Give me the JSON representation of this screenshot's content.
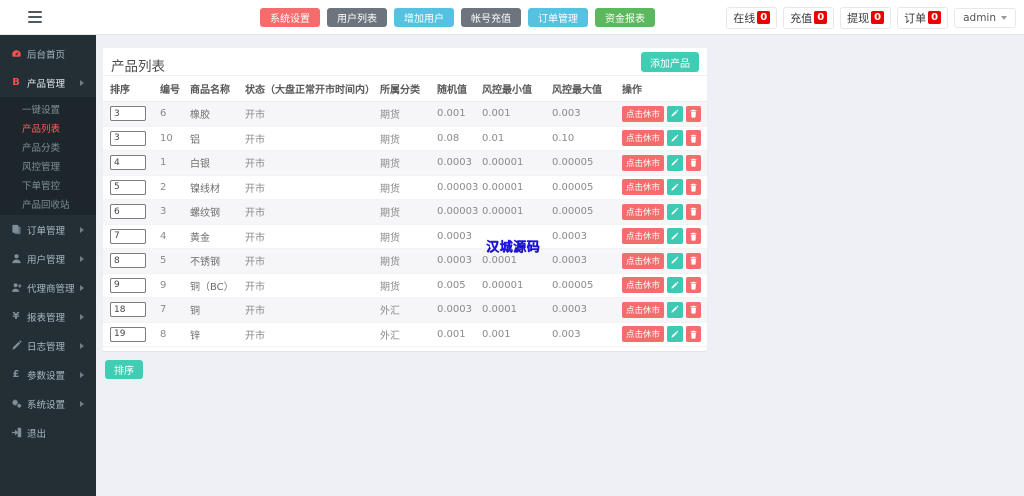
{
  "header": {
    "quick_buttons": [
      {
        "label": "系统设置",
        "style": "red"
      },
      {
        "label": "用户列表",
        "style": "gray"
      },
      {
        "label": "增加用户",
        "style": "blue"
      },
      {
        "label": "帐号充值",
        "style": "gray"
      },
      {
        "label": "订单管理",
        "style": "blue"
      },
      {
        "label": "资金报表",
        "style": "green"
      }
    ],
    "stats": [
      {
        "label": "在线",
        "value": "0"
      },
      {
        "label": "充值",
        "value": "0"
      },
      {
        "label": "提现",
        "value": "0"
      },
      {
        "label": "订单",
        "value": "0"
      }
    ],
    "user": {
      "name": "admin"
    }
  },
  "sidebar": {
    "items": [
      {
        "label": "后台首页",
        "icon": "dashboard-icon",
        "red": true,
        "arrow": false
      },
      {
        "label": "产品管理",
        "icon": "product-icon",
        "red": true,
        "arrow": true,
        "active": true,
        "children": [
          {
            "label": "一键设置",
            "active": false
          },
          {
            "label": "产品列表",
            "active": true
          },
          {
            "label": "产品分类",
            "active": false
          },
          {
            "label": "风控管理",
            "active": false
          },
          {
            "label": "下单管控",
            "active": false
          },
          {
            "label": "产品回收站",
            "active": false
          }
        ]
      },
      {
        "label": "订单管理",
        "icon": "orders-icon",
        "red": false,
        "arrow": true
      },
      {
        "label": "用户管理",
        "icon": "users-icon",
        "red": false,
        "arrow": true
      },
      {
        "label": "代理商管理",
        "icon": "agents-icon",
        "red": false,
        "arrow": true
      },
      {
        "label": "报表管理",
        "icon": "reports-icon",
        "red": false,
        "arrow": true
      },
      {
        "label": "日志管理",
        "icon": "logs-icon",
        "red": false,
        "arrow": true
      },
      {
        "label": "参数设置",
        "icon": "params-icon",
        "red": false,
        "arrow": true
      },
      {
        "label": "系统设置",
        "icon": "system-icon",
        "red": false,
        "arrow": true
      },
      {
        "label": "退出",
        "icon": "logout-icon",
        "red": false,
        "arrow": false
      }
    ]
  },
  "main": {
    "title": "产品列表",
    "add_button": "添加产品",
    "sort_button": "排序",
    "watermark": "汉城源码",
    "table": {
      "headers": [
        "排序",
        "编号",
        "商品名称",
        "状态（大盘正常开市时间内）",
        "所属分类",
        "随机值",
        "风控最小值",
        "风控最大值",
        "操作"
      ],
      "close_label": "点击休市",
      "rows": [
        {
          "sort": "3",
          "id": "6",
          "name": "橡胶",
          "status": "开市",
          "category": "期货",
          "random": "0.001",
          "risk_min": "0.001",
          "risk_max": "0.003"
        },
        {
          "sort": "3",
          "id": "10",
          "name": "铝",
          "status": "开市",
          "category": "期货",
          "random": "0.08",
          "risk_min": "0.01",
          "risk_max": "0.10"
        },
        {
          "sort": "4",
          "id": "1",
          "name": "白银",
          "status": "开市",
          "category": "期货",
          "random": "0.0003",
          "risk_min": "0.00001",
          "risk_max": "0.00005"
        },
        {
          "sort": "5",
          "id": "2",
          "name": "镍线材",
          "status": "开市",
          "category": "期货",
          "random": "0.00003",
          "risk_min": "0.00001",
          "risk_max": "0.00005"
        },
        {
          "sort": "6",
          "id": "3",
          "name": "螺纹钢",
          "status": "开市",
          "category": "期货",
          "random": "0.00003",
          "risk_min": "0.00001",
          "risk_max": "0.00005"
        },
        {
          "sort": "7",
          "id": "4",
          "name": "黄金",
          "status": "开市",
          "category": "期货",
          "random": "0.0003",
          "risk_min": "",
          "risk_max": "0.0003"
        },
        {
          "sort": "8",
          "id": "5",
          "name": "不锈钢",
          "status": "开市",
          "category": "期货",
          "random": "0.0003",
          "risk_min": "0.0001",
          "risk_max": "0.0003"
        },
        {
          "sort": "9",
          "id": "9",
          "name": "铜（BC）",
          "status": "开市",
          "category": "期货",
          "random": "0.005",
          "risk_min": "0.00001",
          "risk_max": "0.00005"
        },
        {
          "sort": "18",
          "id": "7",
          "name": "铜",
          "status": "开市",
          "category": "外汇",
          "random": "0.0003",
          "risk_min": "0.0001",
          "risk_max": "0.0003"
        },
        {
          "sort": "19",
          "id": "8",
          "name": "锌",
          "status": "开市",
          "category": "外汇",
          "random": "0.001",
          "risk_min": "0.001",
          "risk_max": "0.003"
        }
      ]
    }
  },
  "colors": {
    "accent_red": "#f56c6c",
    "accent_gray": "#6c757d",
    "accent_blue": "#54c2e0",
    "accent_green": "#5cb85c",
    "accent_teal": "#41ccb4",
    "badge_red": "#ef0000",
    "sidebar_bg": "#232e35",
    "watermark_blue": "#2016e8"
  }
}
